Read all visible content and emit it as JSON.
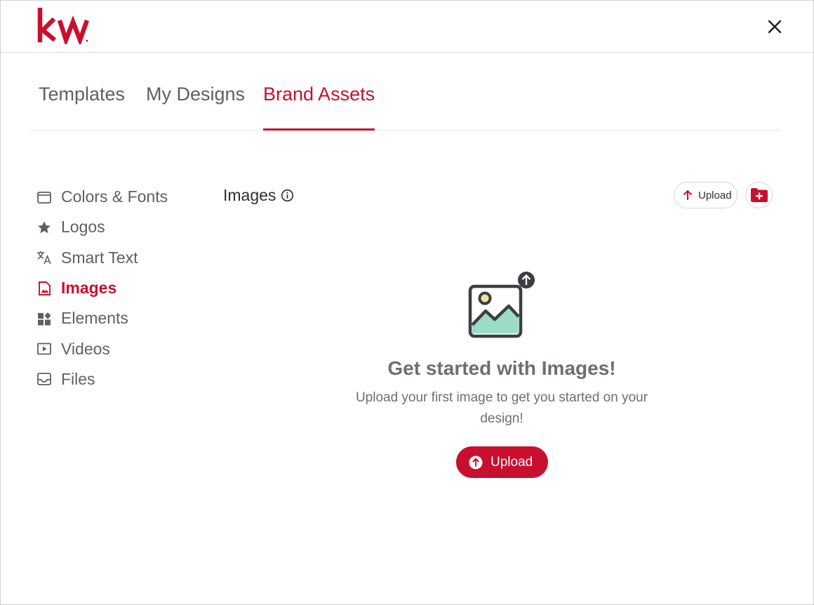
{
  "brand": {
    "logo_text": "kw",
    "accent": "#c8102e"
  },
  "header": {
    "close_icon": "close-icon"
  },
  "tabs": [
    {
      "label": "Templates",
      "active": false
    },
    {
      "label": "My Designs",
      "active": false
    },
    {
      "label": "Brand Assets",
      "active": true
    }
  ],
  "sidebar": {
    "items": [
      {
        "label": "Colors & Fonts",
        "icon": "palette-box-icon",
        "active": false
      },
      {
        "label": "Logos",
        "icon": "star-icon",
        "active": false
      },
      {
        "label": "Smart Text",
        "icon": "translate-icon",
        "active": false
      },
      {
        "label": "Images",
        "icon": "image-file-icon",
        "active": true
      },
      {
        "label": "Elements",
        "icon": "elements-icon",
        "active": false
      },
      {
        "label": "Videos",
        "icon": "video-icon",
        "active": false
      },
      {
        "label": "Files",
        "icon": "inbox-icon",
        "active": false
      }
    ]
  },
  "content": {
    "title": "Images",
    "upload_label": "Upload",
    "empty_state": {
      "title": "Get started with Images!",
      "subtitle": "Upload your first image to get you started on your design!",
      "button_label": "Upload"
    }
  }
}
